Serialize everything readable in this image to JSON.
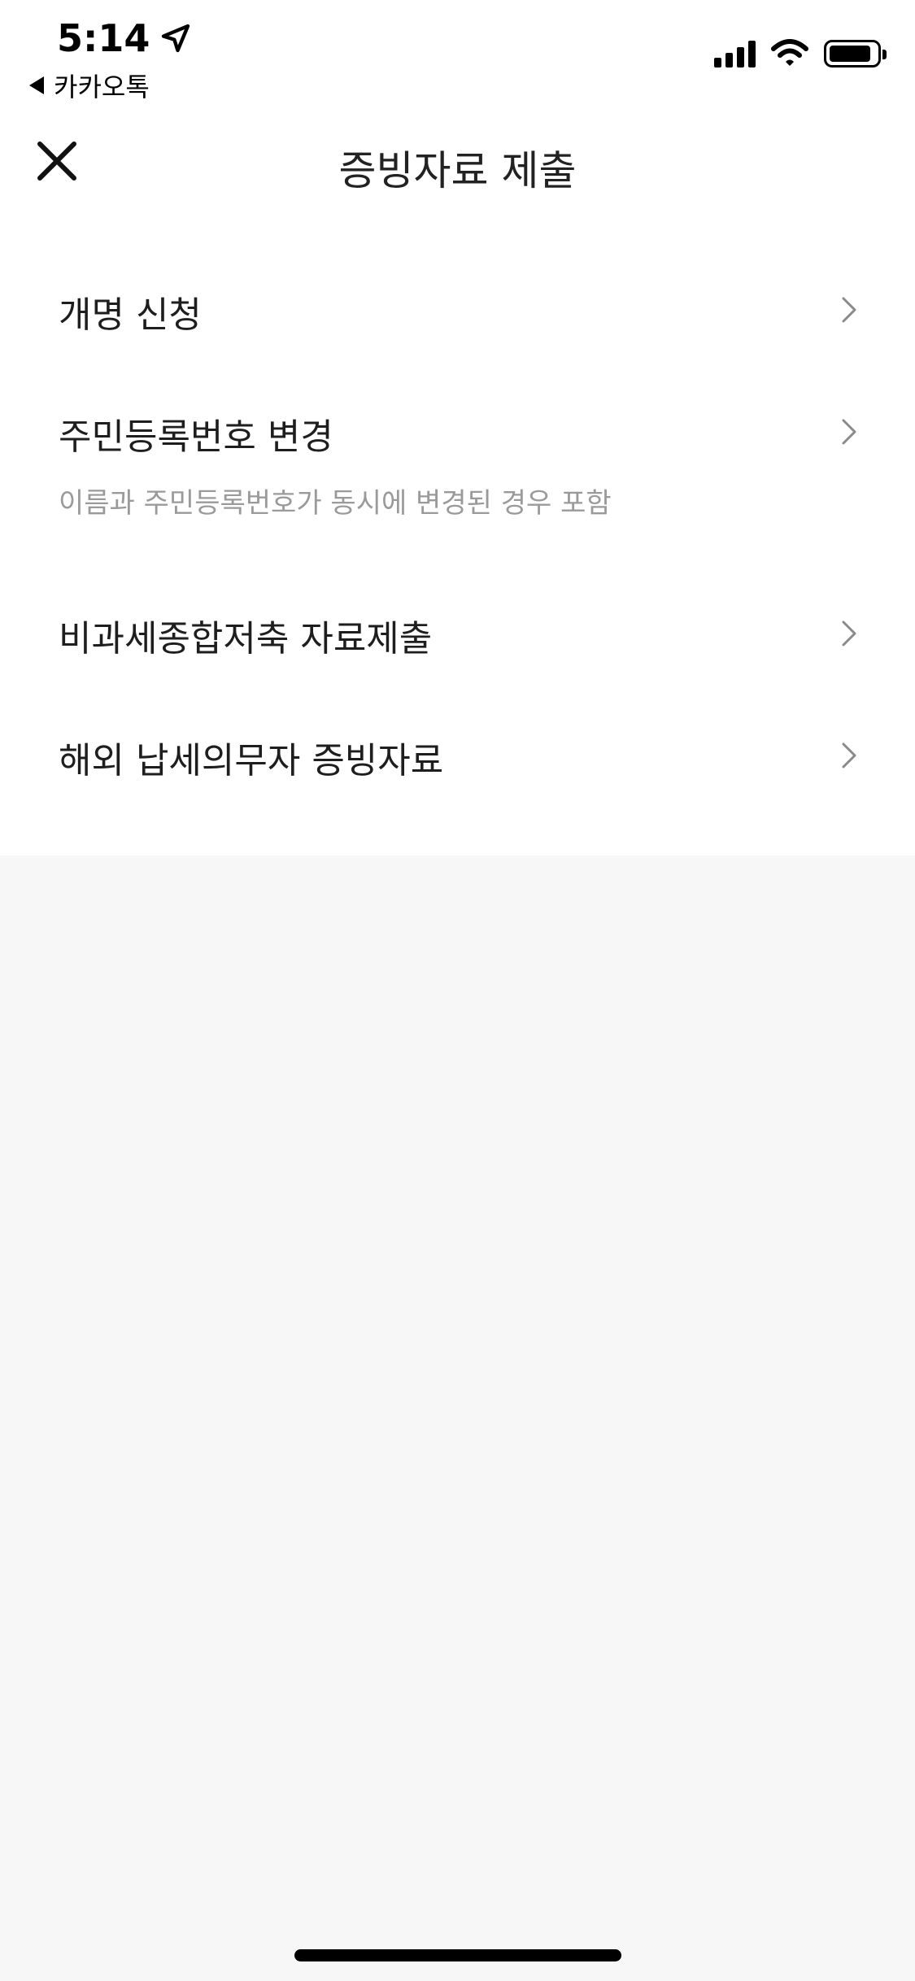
{
  "status_bar": {
    "time": "5:14",
    "back_app": "카카오톡",
    "icons": [
      "location-arrow-icon",
      "signal-icon",
      "wifi-icon",
      "battery-icon"
    ],
    "battery_level": 0.9
  },
  "nav": {
    "title": "증빙자료 제출",
    "close_icon": "close-icon"
  },
  "menu": {
    "items": [
      {
        "label": "개명 신청"
      },
      {
        "label": "주민등록번호 변경",
        "sub": "이름과 주민등록번호가 동시에 변경된 경우 포함"
      },
      {
        "label": "비과세종합저축 자료제출"
      },
      {
        "label": "해외 납세의무자 증빙자료"
      }
    ],
    "chevron_icon": "chevron-right-icon"
  },
  "colors": {
    "content_bg": "#ffffff",
    "page_bg": "#f7f7f7",
    "text": "#1e1e1e",
    "subtext": "#9a9a9a",
    "chevron": "#8a8a8a"
  }
}
